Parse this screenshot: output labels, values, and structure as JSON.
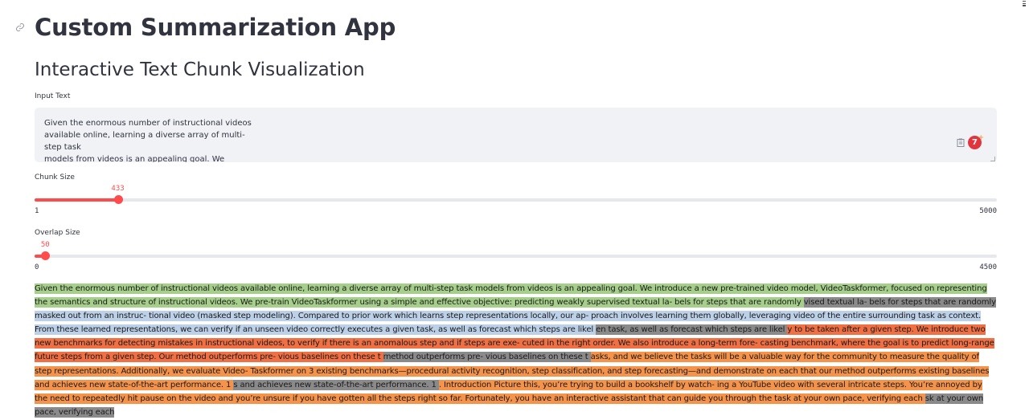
{
  "app": {
    "title": "Custom Summarization App",
    "subtitle": "Interactive Text Chunk Visualization"
  },
  "input": {
    "label": "Input Text",
    "value": "Given the enormous number of instructional videos\navailable online, learning a diverse array of multi-step task\nmodels from videos is an appealing goal. We introduce\na new pre-trained video model, VideoTaskformer, focused"
  },
  "chunk_slider": {
    "label": "Chunk Size",
    "value": "433",
    "min": "1",
    "max": "5000",
    "fraction": 0.0865
  },
  "overlap_slider": {
    "label": "Overlap Size",
    "value": "50",
    "min": "0",
    "max": "4500",
    "fraction": 0.0111
  },
  "chunks": [
    {
      "type": "green",
      "text": "Given the enormous number of instructional videos available online, learning a diverse array of multi-step task models from videos is an appealing goal. We introduce a new pre-trained video model, VideoTaskformer, focused on representing the semantics and structure of instructional videos. We pre-train VideoTaskformer using a simple and effective objective: predicting weakly supervised textual la- bels for steps that are randomly"
    },
    {
      "type": "gray",
      "text": "vised textual la- bels for steps that are randomly"
    },
    {
      "type": "blue",
      "text": "masked out from an instruc- tional video (masked step modeling). Compared to prior work which learns step representations locally, our ap- proach involves learning them globally, leveraging video of the entire surrounding task as context. From these learned representations, we can verify if an unseen video correctly executes a given task, as well as forecast which steps are likel"
    },
    {
      "type": "gray",
      "text": "en task, as well as forecast which steps are likel"
    },
    {
      "type": "red",
      "text": "y to be taken after a given step. We introduce two new benchmarks for detecting mistakes in instructional videos, to verify if there is an anomalous step and if steps are exe- cuted in the right order. We also introduce a long-term fore- casting benchmark, where the goal is to predict long-range future steps from a given step. Our method outperforms pre- vious baselines on these t"
    },
    {
      "type": "gray",
      "text": "method outperforms pre- vious baselines on these t"
    },
    {
      "type": "orange",
      "text": "asks, and we believe the tasks will be a valuable way for the community to measure the quality of step representations. Additionally, we evaluate Video- Taskformer on 3 existing benchmarks—procedural activity recognition, step classification, and step forecasting—and demonstrate on each that our method outperforms existing baselines and achieves new state-of-the-art performance. 1"
    },
    {
      "type": "gray",
      "text": "s and achieves new state-of-the-art performance. 1"
    },
    {
      "type": "orange",
      "text": ". Introduction Picture this, you’re trying to build a bookshelf by watch- ing a YouTube video with several intricate steps. You’re annoyed by the need to repeatedly hit pause on the video and you’re unsure if you have gotten all the steps right so far. Fortunately, you have an interactive assistant that can guide you through the task at your own pace, verifying each"
    },
    {
      "type": "gray",
      "text": "sk at your own pace, verifying each"
    }
  ],
  "colors": {
    "accent": "#ff4b4b",
    "green": "#a6cf8c",
    "gray": "#8a8a8a",
    "blue": "#bcd0e8",
    "red": "#f07044",
    "orange": "#f5934a"
  },
  "icons": [
    "link-icon",
    "menu-icon",
    "clipboard-icon",
    "grammarly-icon"
  ]
}
